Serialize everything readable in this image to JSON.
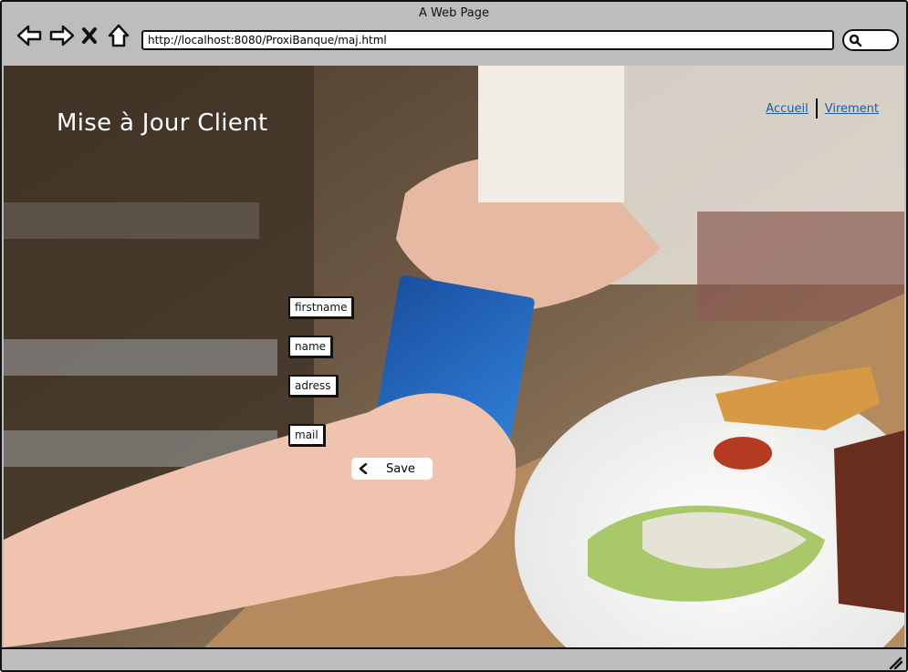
{
  "window": {
    "title": "A Web Page"
  },
  "toolbar": {
    "back_icon": "back-arrow-icon",
    "forward_icon": "forward-arrow-icon",
    "stop_icon": "close-icon",
    "home_icon": "home-icon",
    "url": "http://localhost:8080/ProxiBanque/maj.html",
    "search_icon": "search-icon"
  },
  "page": {
    "title": "Mise à Jour Client",
    "links": [
      "Accueil",
      "Virement"
    ],
    "fields": [
      "firstname",
      "name",
      "adress",
      "mail"
    ],
    "save_label": "Save",
    "background": "photo-hands-credit-card-restaurant"
  }
}
